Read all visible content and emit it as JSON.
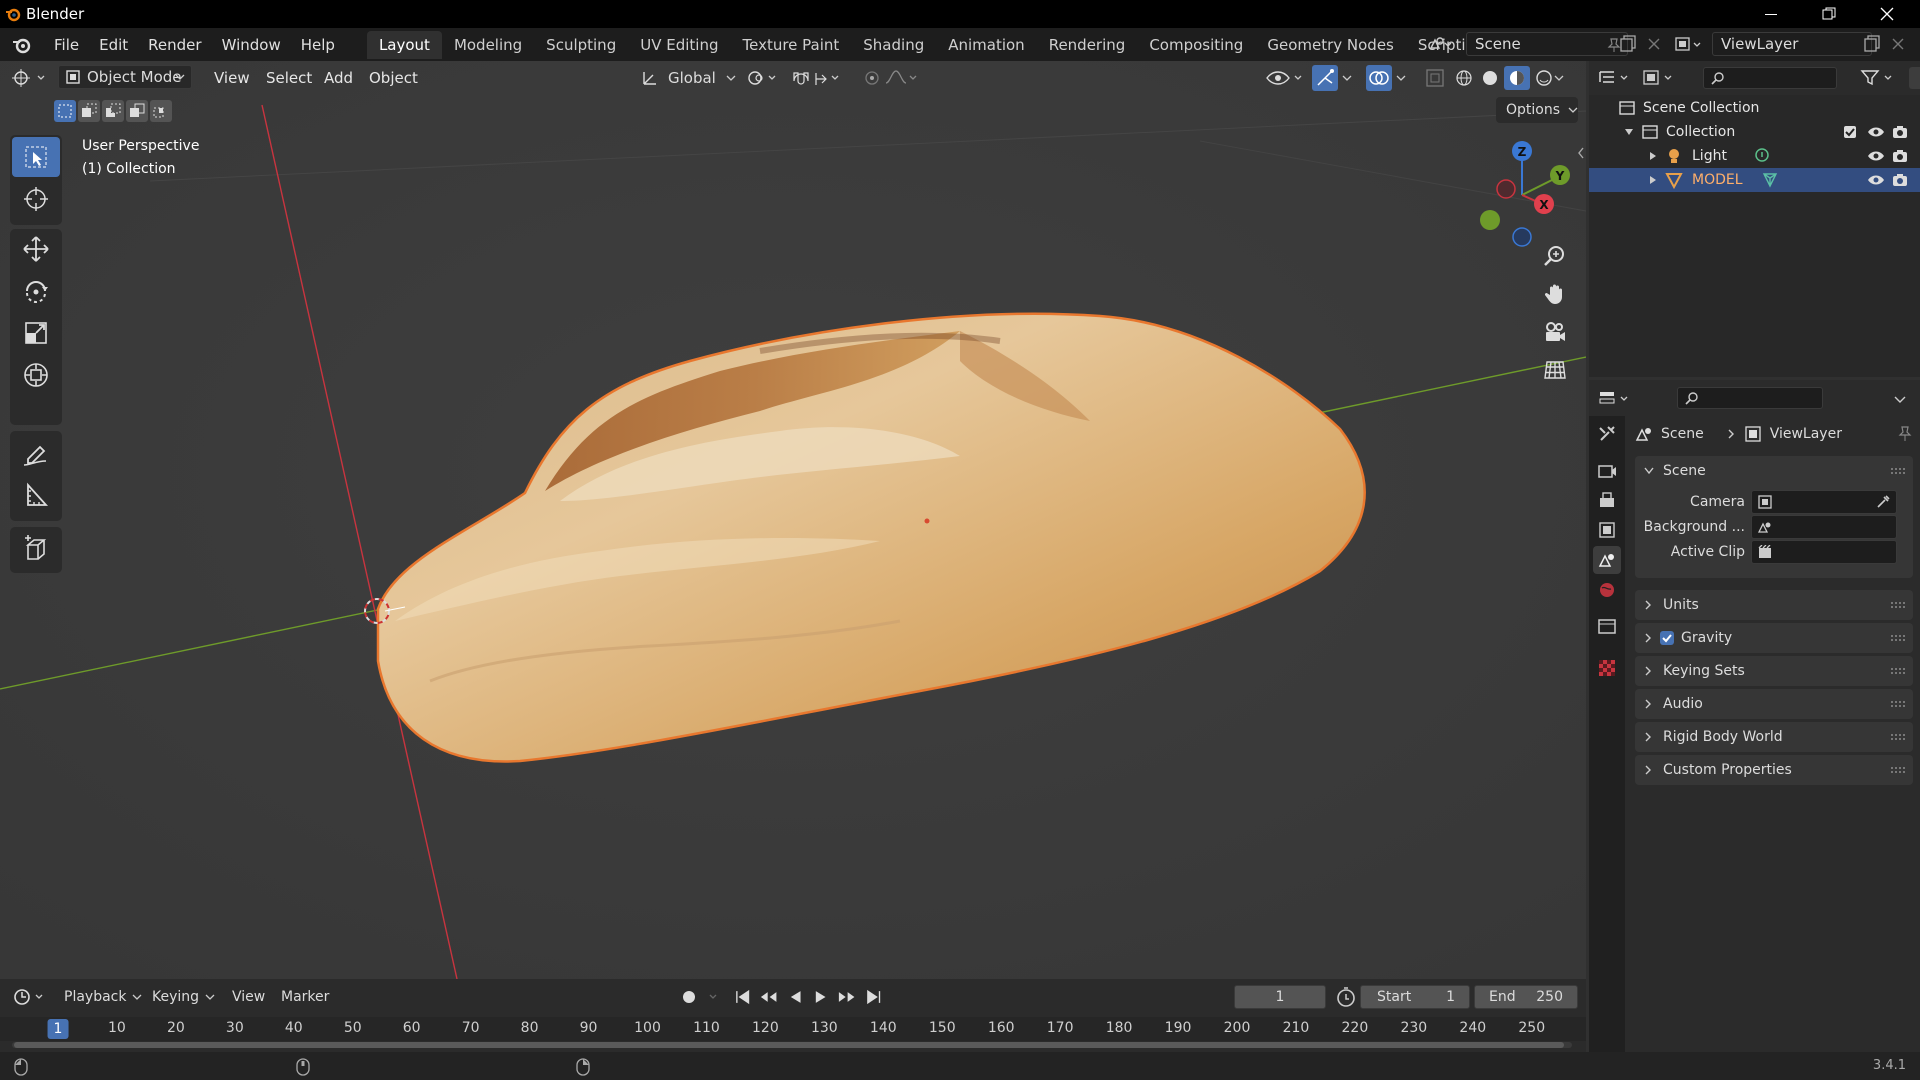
{
  "app": {
    "title": "Blender",
    "version": "3.4.1"
  },
  "menu": [
    "File",
    "Edit",
    "Render",
    "Window",
    "Help"
  ],
  "workspaces": [
    {
      "label": "Layout",
      "active": true
    },
    {
      "label": "Modeling",
      "active": false
    },
    {
      "label": "Sculpting",
      "active": false
    },
    {
      "label": "UV Editing",
      "active": false
    },
    {
      "label": "Texture Paint",
      "active": false
    },
    {
      "label": "Shading",
      "active": false
    },
    {
      "label": "Animation",
      "active": false
    },
    {
      "label": "Rendering",
      "active": false
    },
    {
      "label": "Compositing",
      "active": false
    },
    {
      "label": "Geometry Nodes",
      "active": false
    },
    {
      "label": "Scripting",
      "active": false
    }
  ],
  "add_workspace": "+",
  "scene_field": "Scene",
  "viewlayer_field": "ViewLayer",
  "viewport": {
    "mode": "Object Mode",
    "menus": [
      "View",
      "Select",
      "Add",
      "Object"
    ],
    "transform_orientation": "Global",
    "options_label": "Options",
    "overlay_line1": "User Perspective",
    "overlay_line2": "(1) Collection",
    "gizmo_axes": {
      "x": "X",
      "y": "Y",
      "z": "Z"
    },
    "colors": {
      "x_axis": "#c8343f",
      "y_axis": "#6e9b2a",
      "z_axis": "#3a78d4",
      "selection_outline": "#e8772e",
      "active_tool": "#4772b3"
    }
  },
  "outliner": {
    "root": "Scene Collection",
    "collection": "Collection",
    "items": [
      {
        "label": "Light",
        "selected": false
      },
      {
        "label": "MODEL",
        "selected": true
      }
    ]
  },
  "properties": {
    "breadcrumb": {
      "scene": "Scene",
      "viewlayer": "ViewLayer"
    },
    "scene_panel": "Scene",
    "fields": {
      "camera": "Camera",
      "background": "Background ...",
      "active_clip": "Active Clip"
    },
    "panels": [
      "Units",
      "Gravity",
      "Keying Sets",
      "Audio",
      "Rigid Body World",
      "Custom Properties"
    ],
    "gravity_enabled": true
  },
  "timeline": {
    "menus": [
      "Playback",
      "Keying",
      "View",
      "Marker"
    ],
    "current_frame": "1",
    "start_label": "Start",
    "start_value": "1",
    "end_label": "End",
    "end_value": "250",
    "ruler": [
      "1",
      "10",
      "20",
      "30",
      "40",
      "50",
      "60",
      "70",
      "80",
      "90",
      "100",
      "110",
      "120",
      "130",
      "140",
      "150",
      "160",
      "170",
      "180",
      "190",
      "200",
      "210",
      "220",
      "230",
      "240",
      "250"
    ]
  }
}
